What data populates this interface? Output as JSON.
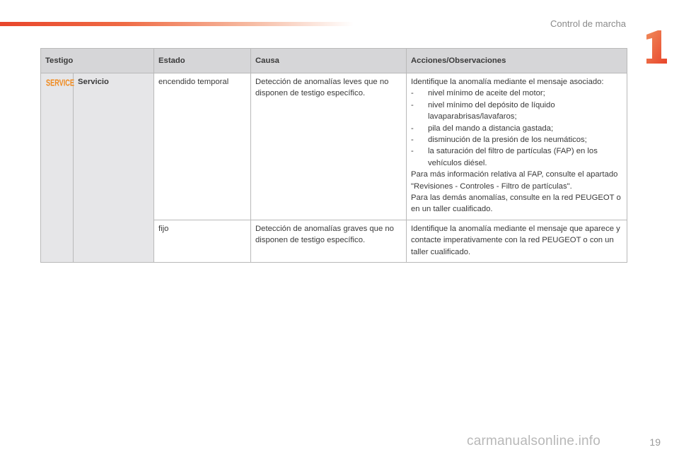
{
  "header": {
    "section_title": "Control de marcha",
    "chapter_number": "1",
    "accent_color": "#e8452b"
  },
  "table": {
    "columns": [
      "Testigo",
      "Estado",
      "Causa",
      "Acciones/Observaciones"
    ],
    "indicator": {
      "icon_label": "SERVICE",
      "icon_color": "#f08a1e",
      "name": "Servicio"
    },
    "rows": [
      {
        "state": "encendido temporal",
        "cause": "Detección de anomalías leves que no disponen de testigo específico.",
        "intro": "Identifique la anomalía mediante el mensaje asociado:",
        "items": [
          "nivel mínimo de aceite del motor;",
          "nivel mínimo del depósito de líquido lavaparabrisas/lavafaros;",
          "pila del mando a distancia gastada;",
          "disminución de la presión de los neumáticos;",
          "la saturación del filtro de partículas (FAP) en los vehículos diésel."
        ],
        "note_1": "Para más información relativa al FAP, consulte el apartado \"Revisiones - Controles - Filtro de partículas\".",
        "note_2": "Para las demás anomalías, consulte en la red PEUGEOT o en un taller cualificado."
      },
      {
        "state": "fijo",
        "cause": "Detección de anomalías graves que no disponen de testigo específico.",
        "action": "Identifique la anomalía mediante el mensaje que aparece y contacte imperativamente con la red PEUGEOT o con un taller cualificado."
      }
    ]
  },
  "footer": {
    "page_number": "19",
    "watermark": "carmanualsonline.info"
  }
}
